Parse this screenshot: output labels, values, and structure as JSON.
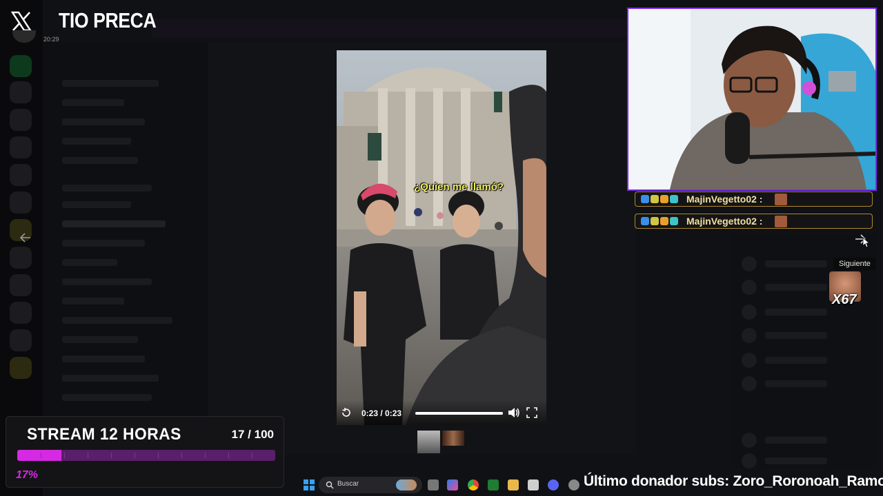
{
  "header": {
    "streamer_name": "TIO PRECA",
    "time": "20:29"
  },
  "video": {
    "caption": "¿Quien me llamó?",
    "time_display": "0:23 / 0:23",
    "progress": 1.0
  },
  "tooltip": {
    "next": "Siguiente"
  },
  "chat": {
    "messages": [
      {
        "user": "MajinVegetto02 :"
      },
      {
        "user": "MajinVegetto02 :"
      }
    ]
  },
  "counter": {
    "label": "X67"
  },
  "goal": {
    "title": "STREAM 12 HORAS",
    "count": "17 / 100",
    "percent_label": "17%",
    "progress": 0.17
  },
  "taskbar": {
    "search_label": "Buscar"
  },
  "ticker": {
    "text": "Último donador subs: Zoro_Roronoah_Ramos"
  },
  "colors": {
    "webcam_border": "#7d2cf0",
    "goal_fill": "#d629e4",
    "caption": "#f2f15a"
  }
}
